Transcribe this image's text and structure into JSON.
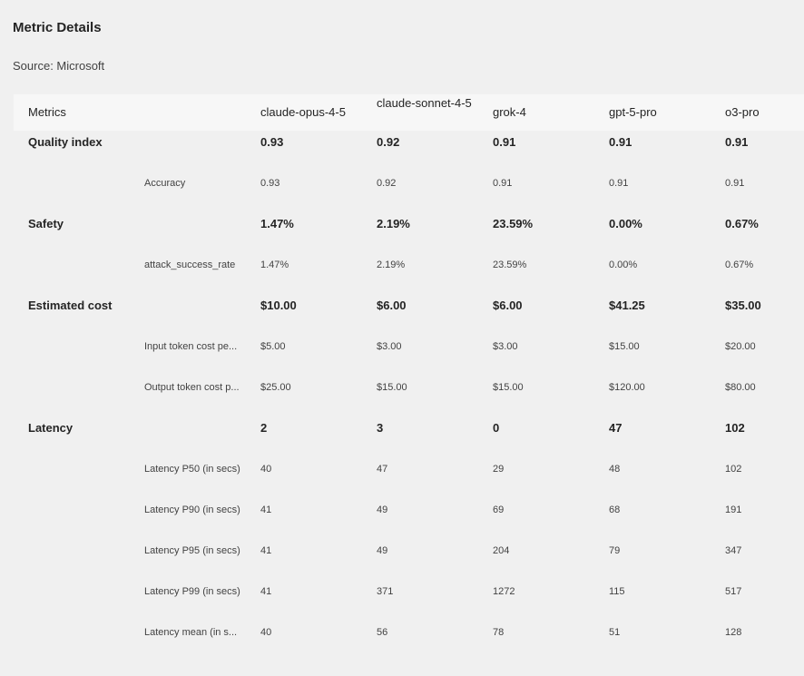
{
  "page": {
    "title": "Metric Details",
    "source": "Source: Microsoft"
  },
  "table": {
    "metrics_header": "Metrics",
    "models": [
      "claude-opus-4-5",
      "claude-sonnet-4-5",
      "grok-4",
      "gpt-5-pro",
      "o3-pro"
    ],
    "groups": [
      {
        "name": "Quality index",
        "values": [
          "0.93",
          "0.92",
          "0.91",
          "0.91",
          "0.91"
        ],
        "rows": [
          {
            "label": "Accuracy",
            "values": [
              "0.93",
              "0.92",
              "0.91",
              "0.91",
              "0.91"
            ]
          }
        ]
      },
      {
        "name": "Safety",
        "values": [
          "1.47%",
          "2.19%",
          "23.59%",
          "0.00%",
          "0.67%"
        ],
        "rows": [
          {
            "label": "attack_success_rate",
            "values": [
              "1.47%",
              "2.19%",
              "23.59%",
              "0.00%",
              "0.67%"
            ]
          }
        ]
      },
      {
        "name": "Estimated cost",
        "values": [
          "$10.00",
          "$6.00",
          "$6.00",
          "$41.25",
          "$35.00"
        ],
        "rows": [
          {
            "label": "Input token cost pe...",
            "values": [
              "$5.00",
              "$3.00",
              "$3.00",
              "$15.00",
              "$20.00"
            ]
          },
          {
            "label": "Output token cost p...",
            "values": [
              "$25.00",
              "$15.00",
              "$15.00",
              "$120.00",
              "$80.00"
            ]
          }
        ]
      },
      {
        "name": "Latency",
        "values": [
          "2",
          "3",
          "0",
          "47",
          "102"
        ],
        "rows": [
          {
            "label": "Latency P50 (in secs)",
            "values": [
              "40",
              "47",
              "29",
              "48",
              "102"
            ]
          },
          {
            "label": "Latency P90 (in secs)",
            "values": [
              "41",
              "49",
              "69",
              "68",
              "191"
            ]
          },
          {
            "label": "Latency P95 (in secs)",
            "values": [
              "41",
              "49",
              "204",
              "79",
              "347"
            ]
          },
          {
            "label": "Latency P99 (in secs)",
            "values": [
              "41",
              "371",
              "1272",
              "115",
              "517"
            ]
          },
          {
            "label": "Latency mean (in s...",
            "values": [
              "40",
              "56",
              "78",
              "51",
              "128"
            ]
          }
        ]
      }
    ]
  }
}
